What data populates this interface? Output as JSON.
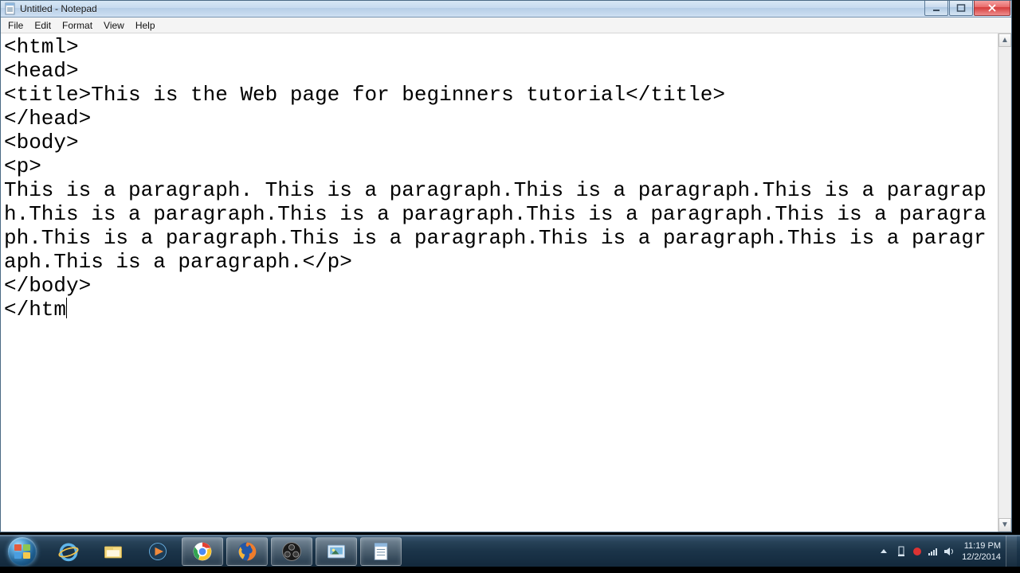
{
  "window": {
    "title": "Untitled - Notepad",
    "menus": [
      "File",
      "Edit",
      "Format",
      "View",
      "Help"
    ]
  },
  "editor": {
    "lines": [
      "<html>",
      "<head>",
      "<title>This is the Web page for beginners tutorial</title>",
      "</head>",
      "<body>",
      "<p>",
      "This is a paragraph. This is a paragraph.This is a paragraph.This is a paragraph.This is a paragraph.This is a paragraph.This is a paragraph.This is a paragraph.This is a paragraph.This is a paragraph.This is a paragraph.This is a paragraph.This is a paragraph.</p>",
      "</body>",
      "</htm"
    ]
  },
  "taskbar": {
    "icons": [
      {
        "name": "ie-icon"
      },
      {
        "name": "explorer-icon"
      },
      {
        "name": "wmplayer-icon"
      },
      {
        "name": "chrome-icon",
        "running": true
      },
      {
        "name": "firefox-icon",
        "running": true
      },
      {
        "name": "obs-icon",
        "running": true
      },
      {
        "name": "gallery-icon",
        "running": true
      },
      {
        "name": "notepad-icon",
        "running": true
      }
    ]
  },
  "tray": {
    "time": "11:19 PM",
    "date": "12/2/2014"
  }
}
